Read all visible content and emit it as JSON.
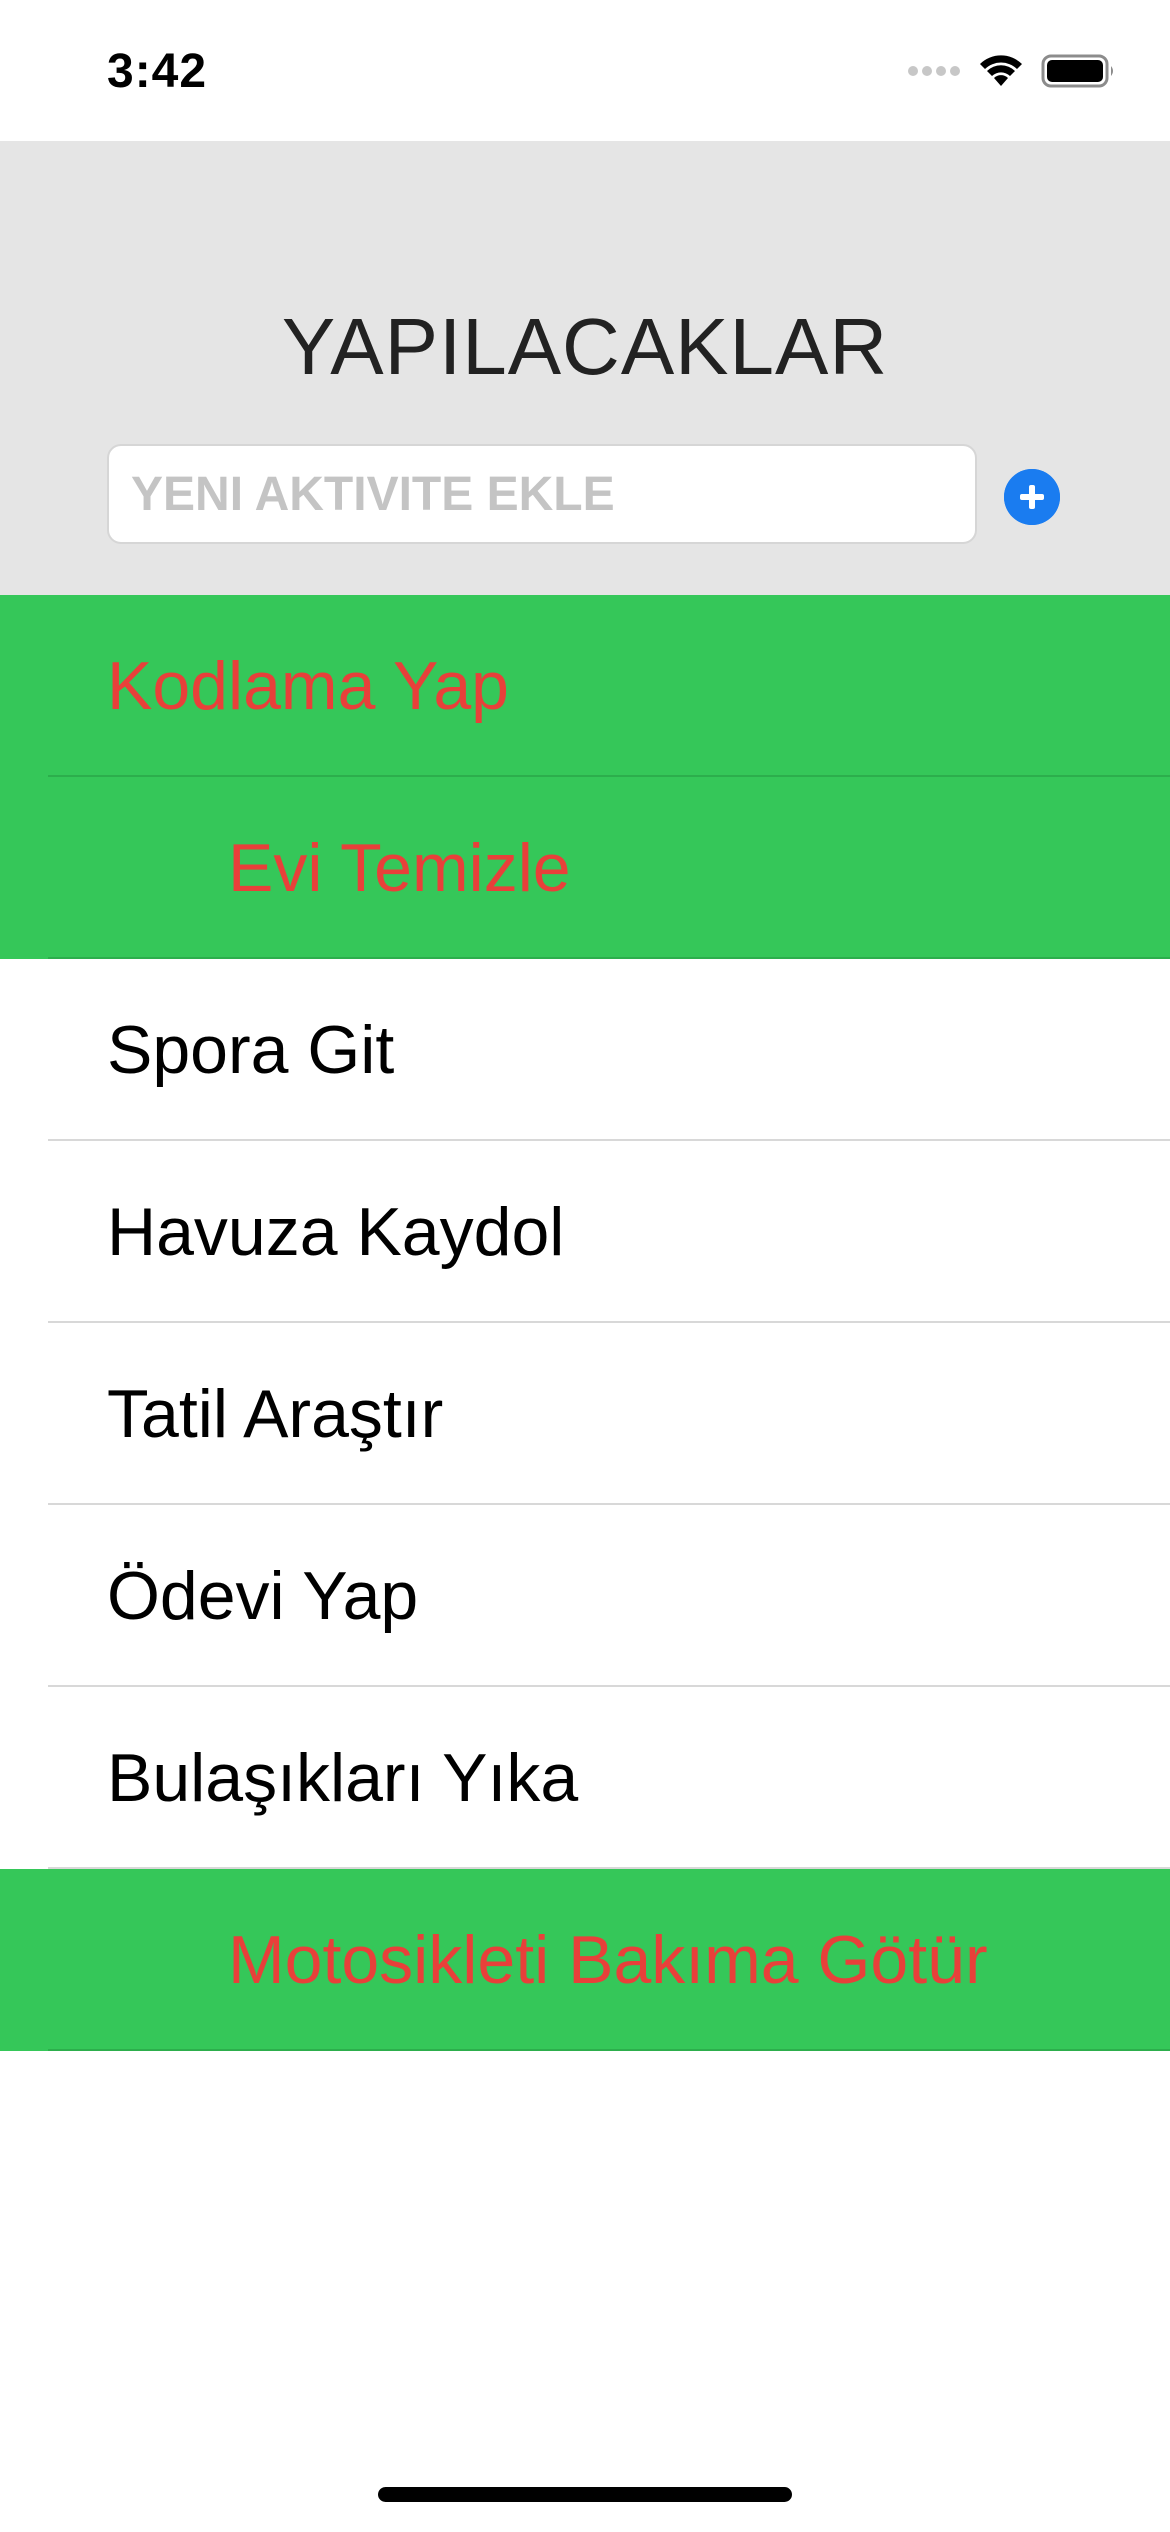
{
  "status_bar": {
    "time": "3:42"
  },
  "header": {
    "title": "YAPILACAKLAR",
    "input_placeholder": "YENI AKTIVITE EKLE",
    "input_value": "",
    "add_icon": "plus-circle-icon"
  },
  "colors": {
    "header_bg": "#e5e5e5",
    "done_row_bg": "#35c759",
    "done_text": "#e8403a",
    "accent": "#1a7cf0"
  },
  "tasks": [
    {
      "label": "Kodlama Yap",
      "done": true,
      "indented": false
    },
    {
      "label": "Evi Temizle",
      "done": true,
      "indented": true
    },
    {
      "label": "Spora Git",
      "done": false,
      "indented": false
    },
    {
      "label": "Havuza Kaydol",
      "done": false,
      "indented": false
    },
    {
      "label": "Tatil Araştır",
      "done": false,
      "indented": false
    },
    {
      "label": "Ödevi Yap",
      "done": false,
      "indented": false
    },
    {
      "label": "Bulaşıkları Yıka",
      "done": false,
      "indented": false
    },
    {
      "label": "Motosikleti Bakıma Götür",
      "done": true,
      "indented": true
    }
  ]
}
